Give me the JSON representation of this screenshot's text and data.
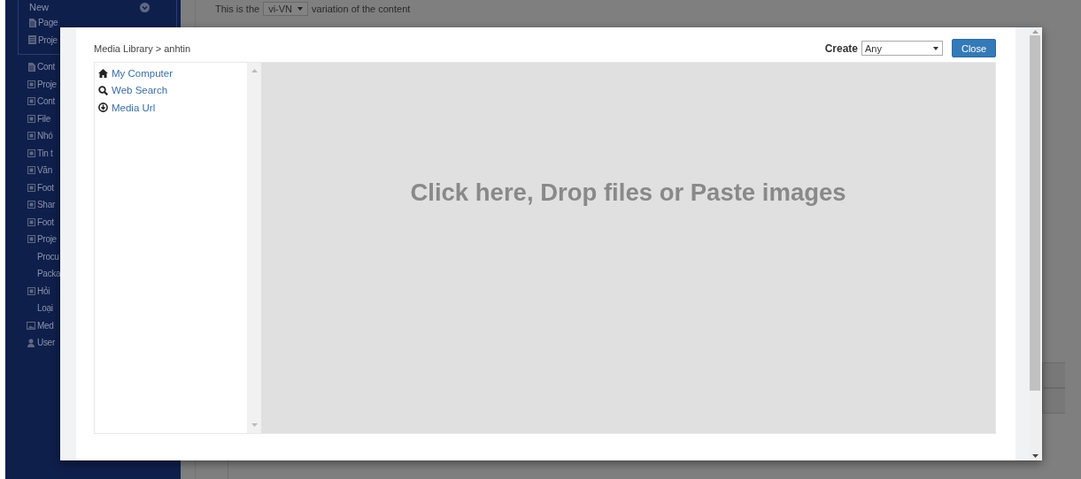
{
  "page": {
    "variation_prefix": "This is the",
    "variation_value": "vi-VN",
    "variation_suffix": "variation of the content"
  },
  "sidebar": {
    "group": {
      "label": "New",
      "items": [
        {
          "label": "Page",
          "kind": "page"
        },
        {
          "label": "Proje",
          "kind": "list"
        }
      ]
    },
    "items": [
      {
        "label": "Cont",
        "kind": "page"
      },
      {
        "label": "Proje",
        "kind": "box"
      },
      {
        "label": "Cont",
        "kind": "box"
      },
      {
        "label": "File",
        "kind": "box"
      },
      {
        "label": "Nhó",
        "kind": "box"
      },
      {
        "label": "Tin t",
        "kind": "box"
      },
      {
        "label": "Văn",
        "kind": "box"
      },
      {
        "label": "Foot",
        "kind": "box"
      },
      {
        "label": "Shar",
        "kind": "box"
      },
      {
        "label": "Foot",
        "kind": "box"
      },
      {
        "label": "Proje",
        "kind": "box"
      },
      {
        "label": "Procu",
        "kind": "sub"
      },
      {
        "label": "Packa",
        "kind": "sub"
      },
      {
        "label": "Hỏi",
        "kind": "box"
      },
      {
        "label": "Loại",
        "kind": "sub"
      },
      {
        "label": "Med",
        "kind": "image"
      },
      {
        "label": "User",
        "kind": "user"
      }
    ]
  },
  "modal": {
    "breadcrumb": "Media Library > anhtin",
    "create_label": "Create",
    "create_value": "Any",
    "close_button": "Close",
    "sources": [
      {
        "label": "My Computer",
        "kind": "home"
      },
      {
        "label": "Web Search",
        "kind": "search"
      },
      {
        "label": "Media Url",
        "kind": "download"
      }
    ],
    "drop_zone": "Click here, Drop files or Paste images"
  }
}
